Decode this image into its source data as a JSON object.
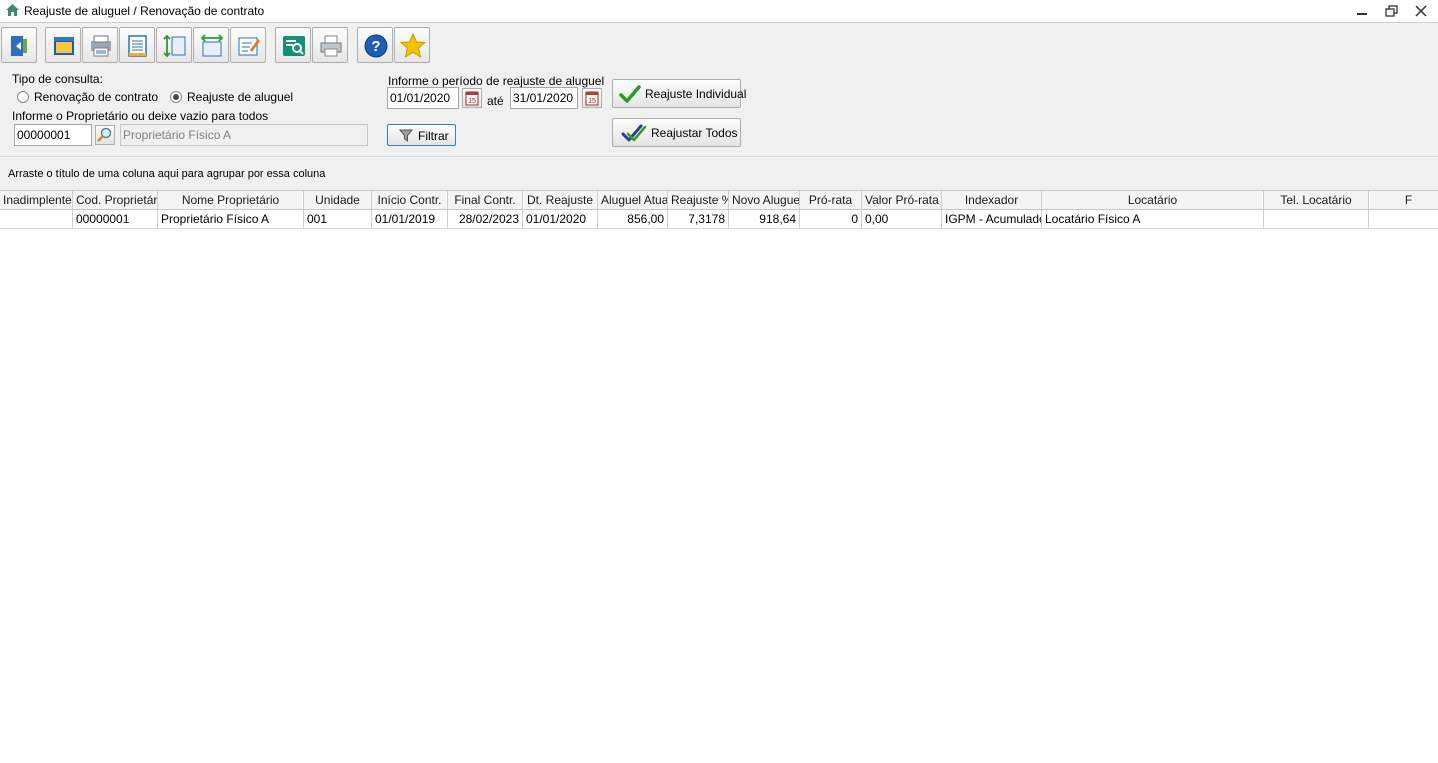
{
  "window": {
    "title": "Reajuste de aluguel / Renovação de contrato",
    "controls": [
      "minimize",
      "restore",
      "close"
    ]
  },
  "toolbar": {
    "buttons": [
      {
        "icon": "exit-door-icon"
      },
      {
        "icon": "window-icon"
      },
      {
        "icon": "printer-list-icon"
      },
      {
        "icon": "document-list-icon"
      },
      {
        "icon": "expand-rows-icon"
      },
      {
        "icon": "fit-columns-icon"
      },
      {
        "icon": "edit-grid-icon"
      },
      {
        "icon": "preview-search-icon"
      },
      {
        "icon": "printer-icon"
      },
      {
        "icon": "help-icon"
      },
      {
        "icon": "favorite-star-icon"
      }
    ]
  },
  "filters": {
    "tipo_label": "Tipo de consulta:",
    "radio_renovacao": "Renovação de contrato",
    "radio_reajuste": "Reajuste de aluguel",
    "selected": "Reajuste de aluguel",
    "proprietario_label": "Informe o Proprietário ou deixe vazio para todos",
    "proprietario_code": "00000001",
    "proprietario_name": "Proprietário Físico A",
    "periodo_label": "Informe o período de reajuste de aluguel",
    "date_from": "01/01/2020",
    "ate_label": "até",
    "date_to": "31/01/2020",
    "filtrar_label": "Filtrar",
    "btn_individual": "Reajuste Individual",
    "btn_todos": "Reajustar Todos"
  },
  "group_hint": "Arraste o título de uma coluna aqui para agrupar por essa coluna",
  "grid": {
    "columns": [
      "Inadimplente",
      "Cod. Proprietário",
      "Nome Proprietário",
      "Unidade",
      "Início Contr.",
      "Final Contr.",
      "Dt. Reajuste",
      "Aluguel Atual",
      "Reajuste %",
      "Novo Aluguel",
      "Pró-rata",
      "Valor Pró-rata",
      "Indexador",
      "Locatário",
      "Tel. Locatário",
      "F"
    ],
    "rows": [
      [
        "",
        "00000001",
        "Proprietário Físico A",
        "001",
        "01/01/2019",
        "28/02/2023",
        "01/01/2020",
        "856,00",
        "7,3178",
        "918,64",
        "0",
        "0,00",
        "IGPM - Acumulado",
        "Locatário Físico A",
        "",
        ""
      ]
    ]
  },
  "colors": {
    "accent": "#1e5fb4",
    "check_green": "#2e9a2e",
    "star": "#f5c400"
  }
}
